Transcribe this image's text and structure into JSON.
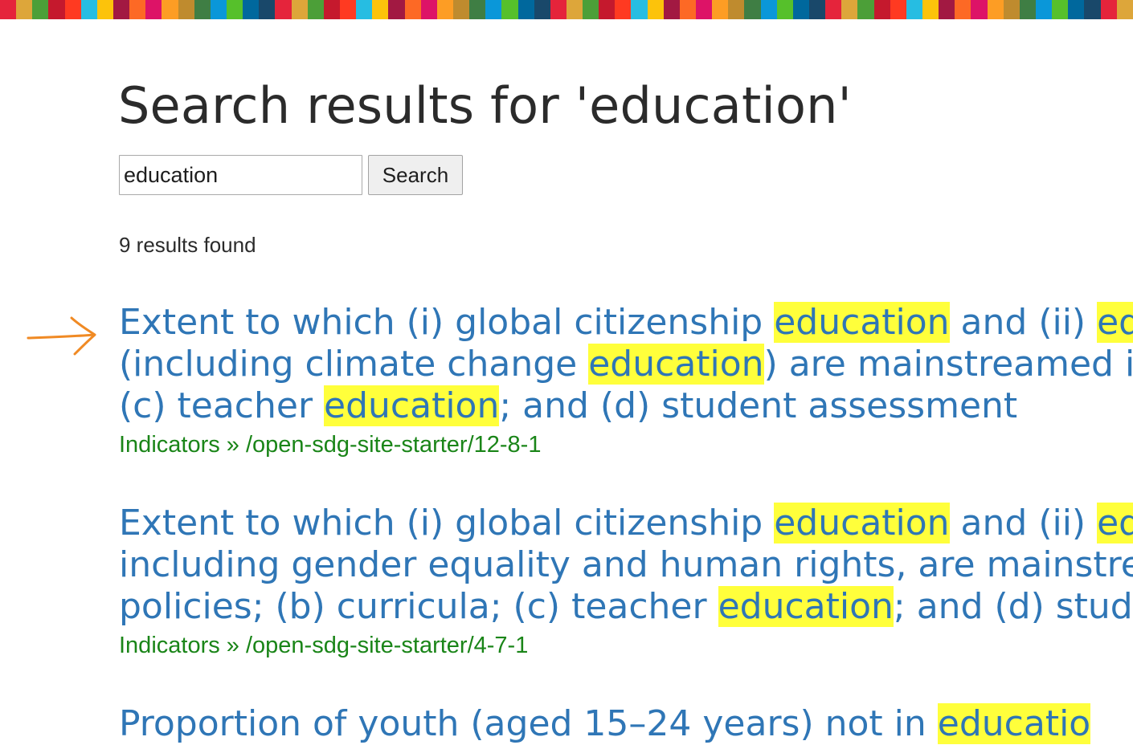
{
  "sdg_bar_colors": [
    "#e5243b",
    "#dda63a",
    "#4c9f38",
    "#c5192d",
    "#ff3a21",
    "#26bde2",
    "#fcc30b",
    "#a21942",
    "#fd6925",
    "#dd1367",
    "#fd9d24",
    "#bf8b2e",
    "#3f7e44",
    "#0a97d9",
    "#56c02b",
    "#00689d",
    "#19486a",
    "#e5243b",
    "#dda63a",
    "#4c9f38",
    "#c5192d",
    "#ff3a21",
    "#26bde2",
    "#fcc30b",
    "#a21942",
    "#fd6925",
    "#dd1367",
    "#fd9d24",
    "#bf8b2e",
    "#3f7e44",
    "#0a97d9",
    "#56c02b",
    "#00689d",
    "#19486a",
    "#e5243b",
    "#dda63a",
    "#4c9f38",
    "#c5192d",
    "#ff3a21",
    "#26bde2",
    "#fcc30b",
    "#a21942",
    "#fd6925",
    "#dd1367",
    "#fd9d24",
    "#bf8b2e",
    "#3f7e44",
    "#0a97d9",
    "#56c02b",
    "#00689d",
    "#19486a",
    "#e5243b",
    "#dda63a",
    "#4c9f38",
    "#c5192d",
    "#ff3a21",
    "#26bde2",
    "#fcc30b",
    "#a21942",
    "#fd6925",
    "#dd1367",
    "#fd9d24",
    "#bf8b2e",
    "#3f7e44",
    "#0a97d9",
    "#56c02b",
    "#00689d",
    "#19486a",
    "#e5243b",
    "#dda63a"
  ],
  "page": {
    "title": "Search results for 'education'"
  },
  "search": {
    "value": "education",
    "button_label": "Search"
  },
  "results_count": "9 results found",
  "annotation": {
    "arrow_color": "#f08a24",
    "icon": "arrow-right-icon"
  },
  "highlight_color": "#ffff3b",
  "results": [
    {
      "title_lines": [
        [
          "Extent to which (i) global citizenship ",
          "education",
          " and (ii) ",
          "ed"
        ],
        [
          "(including climate change ",
          "education",
          ") are mainstreamed i"
        ],
        [
          "(c) teacher ",
          "education",
          "; and (d) student assessment"
        ]
      ],
      "url": "Indicators » /open-sdg-site-starter/12-8-1"
    },
    {
      "title_lines": [
        [
          "Extent to which (i) global citizenship ",
          "education",
          " and (ii) ",
          "ed"
        ],
        [
          "including gender equality and human rights, are mainstre"
        ],
        [
          "policies; (b) curricula; (c) teacher ",
          "education",
          "; and (d) stude"
        ]
      ],
      "url": "Indicators » /open-sdg-site-starter/4-7-1"
    },
    {
      "title_lines": [
        [
          "Proportion of youth (aged 15–24 years) not in ",
          "educatio"
        ]
      ],
      "url": ""
    }
  ]
}
